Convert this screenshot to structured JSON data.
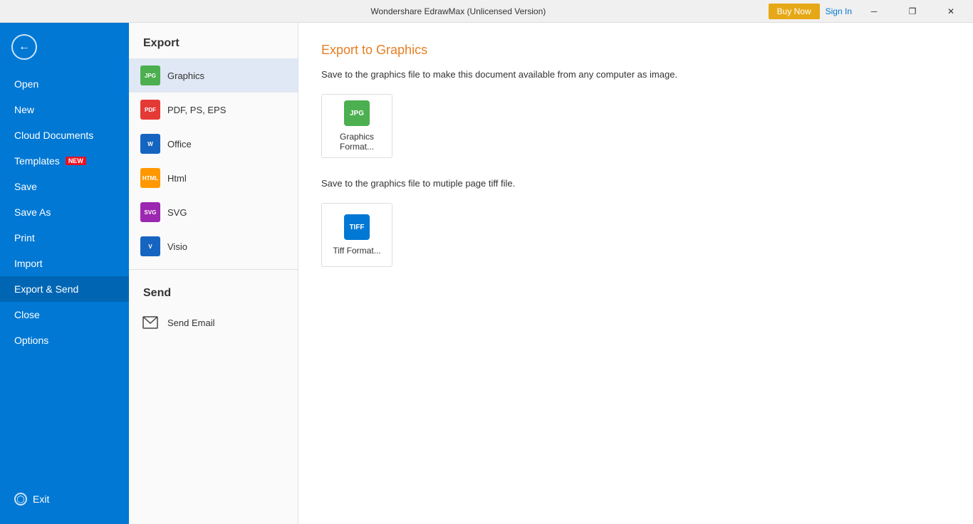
{
  "titlebar": {
    "title": "Wondershare EdrawMax (Unlicensed Version)",
    "minimize_label": "─",
    "restore_label": "❐",
    "close_label": "✕",
    "buy_now_label": "Buy Now",
    "sign_in_label": "Sign In"
  },
  "sidebar": {
    "back_tooltip": "Back",
    "items": [
      {
        "id": "open",
        "label": "Open",
        "active": false
      },
      {
        "id": "new",
        "label": "New",
        "active": false
      },
      {
        "id": "cloud-documents",
        "label": "Cloud Documents",
        "active": false
      },
      {
        "id": "templates",
        "label": "Templates",
        "badge": "NEW",
        "active": false
      },
      {
        "id": "save",
        "label": "Save",
        "active": false
      },
      {
        "id": "save-as",
        "label": "Save As",
        "active": false
      },
      {
        "id": "print",
        "label": "Print",
        "active": false
      },
      {
        "id": "import",
        "label": "Import",
        "active": false
      },
      {
        "id": "export-send",
        "label": "Export & Send",
        "active": true
      },
      {
        "id": "close",
        "label": "Close",
        "active": false
      },
      {
        "id": "options",
        "label": "Options",
        "active": false
      }
    ],
    "exit_label": "Exit"
  },
  "middle_panel": {
    "export_title": "Export",
    "items": [
      {
        "id": "graphics",
        "label": "Graphics",
        "fmt": "jpg",
        "fmt_text": "JPG",
        "active": true
      },
      {
        "id": "pdf",
        "label": "PDF, PS, EPS",
        "fmt": "pdf",
        "fmt_text": "PDF",
        "active": false
      },
      {
        "id": "office",
        "label": "Office",
        "fmt": "word",
        "fmt_text": "W",
        "active": false
      },
      {
        "id": "html",
        "label": "Html",
        "fmt": "html",
        "fmt_text": "HTML",
        "active": false
      },
      {
        "id": "svg",
        "label": "SVG",
        "fmt": "svg",
        "fmt_text": "SVG",
        "active": false
      },
      {
        "id": "visio",
        "label": "Visio",
        "fmt": "visio",
        "fmt_text": "V",
        "active": false
      }
    ],
    "send_title": "Send",
    "send_items": [
      {
        "id": "send-email",
        "label": "Send Email"
      }
    ]
  },
  "content": {
    "title": "Export to Graphics",
    "desc1": "Save to the graphics file to make this document available from any computer as image.",
    "card1_label": "Graphics Format...",
    "card1_icon": "JPG",
    "desc2": "Save to the graphics file to mutiple page tiff file.",
    "card2_label": "Tiff Format...",
    "card2_icon": "TIFF"
  }
}
